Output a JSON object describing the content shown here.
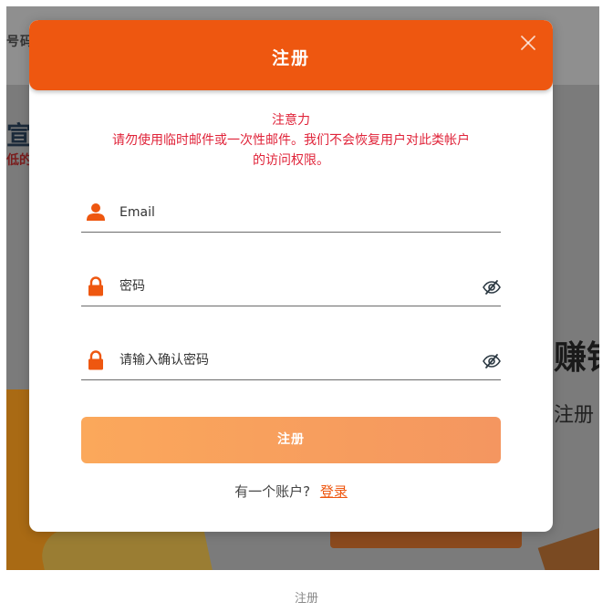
{
  "background": {
    "tab_text": "号码",
    "hero_title": "宣",
    "hero_sub": "低的",
    "right_title": "赚钱",
    "right_sub": "注册"
  },
  "modal": {
    "title": "注册",
    "close_icon": "close-icon",
    "notice": {
      "heading": "注意力",
      "line1": "请勿使用临时邮件或一次性邮件。我们不会恢复用户对此类帐户",
      "line2": "的访问权限。"
    },
    "fields": {
      "email": {
        "placeholder": "Email",
        "value": "",
        "icon": "user-icon"
      },
      "password": {
        "placeholder": "密码",
        "value": "",
        "icon": "lock-icon",
        "toggle_icon": "eye-off-icon"
      },
      "confirm": {
        "placeholder": "请输入确认密码",
        "value": "",
        "icon": "lock-icon",
        "toggle_icon": "eye-off-icon"
      }
    },
    "submit_label": "注册",
    "login_prompt": "有一个账户?",
    "login_link": "登录"
  },
  "caption": "注册",
  "colors": {
    "accent": "#ee5710",
    "notice": "#e0243a",
    "button_start": "#fba85b",
    "button_end": "#f49660"
  }
}
